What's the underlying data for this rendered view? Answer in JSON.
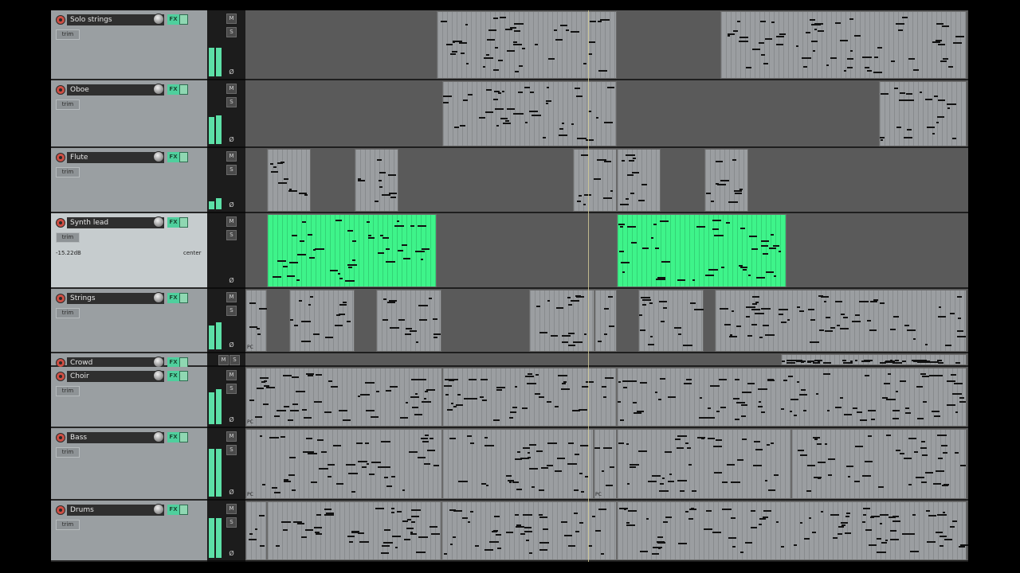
{
  "tracks": [
    {
      "name": "Solo strings",
      "trim": "trim",
      "fx": "FX",
      "mute": "M",
      "solo": "S",
      "selected": false
    },
    {
      "name": "Oboe",
      "trim": "trim",
      "fx": "FX",
      "mute": "M",
      "solo": "S",
      "selected": false
    },
    {
      "name": "Flute",
      "trim": "trim",
      "fx": "FX",
      "mute": "M",
      "solo": "S",
      "selected": false
    },
    {
      "name": "Synth lead",
      "trim": "trim",
      "fx": "FX",
      "mute": "M",
      "solo": "S",
      "selected": true,
      "volume": "-15.22dB",
      "pan": "center"
    },
    {
      "name": "Strings",
      "trim": "trim",
      "fx": "FX",
      "mute": "M",
      "solo": "S",
      "selected": false
    },
    {
      "name": "Crowd",
      "trim": "trim",
      "fx": "FX",
      "mute": "M",
      "solo": "S",
      "selected": false
    },
    {
      "name": "Choir",
      "trim": "trim",
      "fx": "FX",
      "mute": "M",
      "solo": "S",
      "selected": false
    },
    {
      "name": "Bass",
      "trim": "trim",
      "fx": "FX",
      "mute": "M",
      "solo": "S",
      "selected": false
    },
    {
      "name": "Drums",
      "trim": "trim",
      "fx": "FX",
      "mute": "M",
      "solo": "S",
      "selected": false
    }
  ],
  "phase_symbol": "Ø",
  "item_labels": {
    "pc": "PC"
  },
  "colors": {
    "item_grey": "#9b9ea1",
    "item_selected": "#3ef48a",
    "meter": "#5ce0a7",
    "record": "#cf4f44",
    "fx": "#4fcf9d"
  },
  "icons": {
    "record": "record-arm-icon",
    "pan": "pan-knob-icon",
    "trim": "envelope-icon",
    "phase": "phase-icon"
  }
}
